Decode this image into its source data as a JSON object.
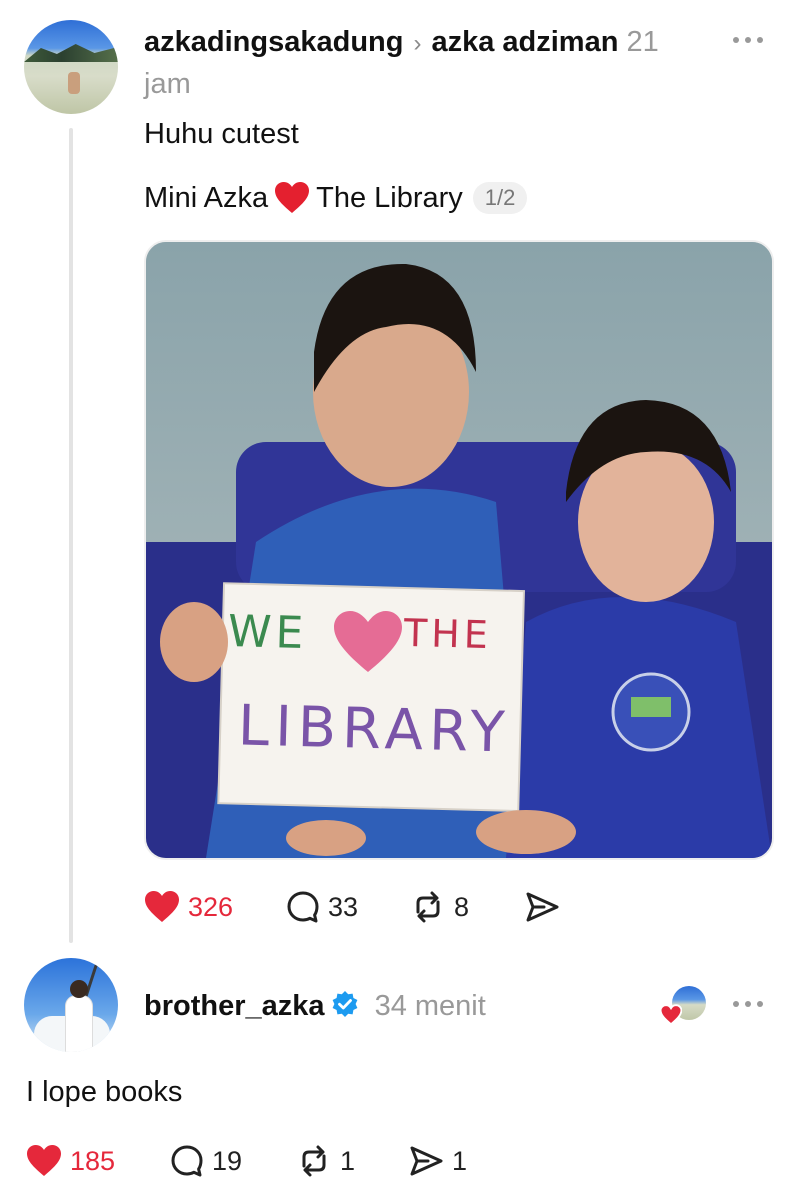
{
  "post": {
    "author": "azkadingsakadung",
    "reply_to": "azka adziman",
    "time_line1": "21",
    "time_line2": "jam",
    "text_line1": "Huhu cutest",
    "text_line2_a": "Mini Azka",
    "text_line2_b": "The Library",
    "media_counter": "1/2",
    "sign_line1": "WE",
    "sign_line1_b": "THE",
    "sign_line2": "LIBRARY",
    "actions": {
      "likes": "326",
      "comments": "33",
      "reposts": "8"
    }
  },
  "reply": {
    "author": "brother_azka",
    "time": "34 menit",
    "text": "I lope books",
    "actions": {
      "likes": "185",
      "comments": "19",
      "reposts": "1",
      "shares": "1"
    }
  },
  "icons": {
    "more": "more-horizontal-icon",
    "like": "heart-icon",
    "comment": "comment-bubble-icon",
    "repost": "repost-icon",
    "share": "send-icon",
    "verified": "verified-badge-icon"
  },
  "colors": {
    "like_red": "#e5283b",
    "verified_blue": "#1d9bf0",
    "muted_gray": "#999999"
  }
}
